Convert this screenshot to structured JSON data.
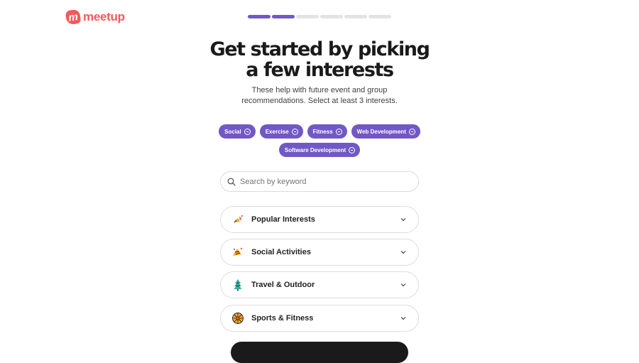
{
  "brand": {
    "name": "meetup",
    "mark": "m",
    "color": "#f65858"
  },
  "progress": {
    "total_steps": 6,
    "completed_steps": 2,
    "accent": "#7158c6"
  },
  "heading": {
    "line1": "Get started by picking",
    "line2": "a few interests"
  },
  "subtitle": {
    "line1": "These help with future event and group",
    "line2": "recommendations. Select at least 3 interests."
  },
  "selected_interests": [
    {
      "label": "Social"
    },
    {
      "label": "Exercise"
    },
    {
      "label": "Fitness"
    },
    {
      "label": "Web Development"
    },
    {
      "label": "Software Development"
    }
  ],
  "search": {
    "placeholder": "Search by keyword",
    "value": "",
    "icon": "search-icon"
  },
  "categories": [
    {
      "label": "Popular Interests",
      "icon": "sparkle-icon"
    },
    {
      "label": "Social Activities",
      "icon": "party-icon"
    },
    {
      "label": "Travel & Outdoor",
      "icon": "tree-icon"
    },
    {
      "label": "Sports & Fitness",
      "icon": "ball-icon"
    }
  ]
}
